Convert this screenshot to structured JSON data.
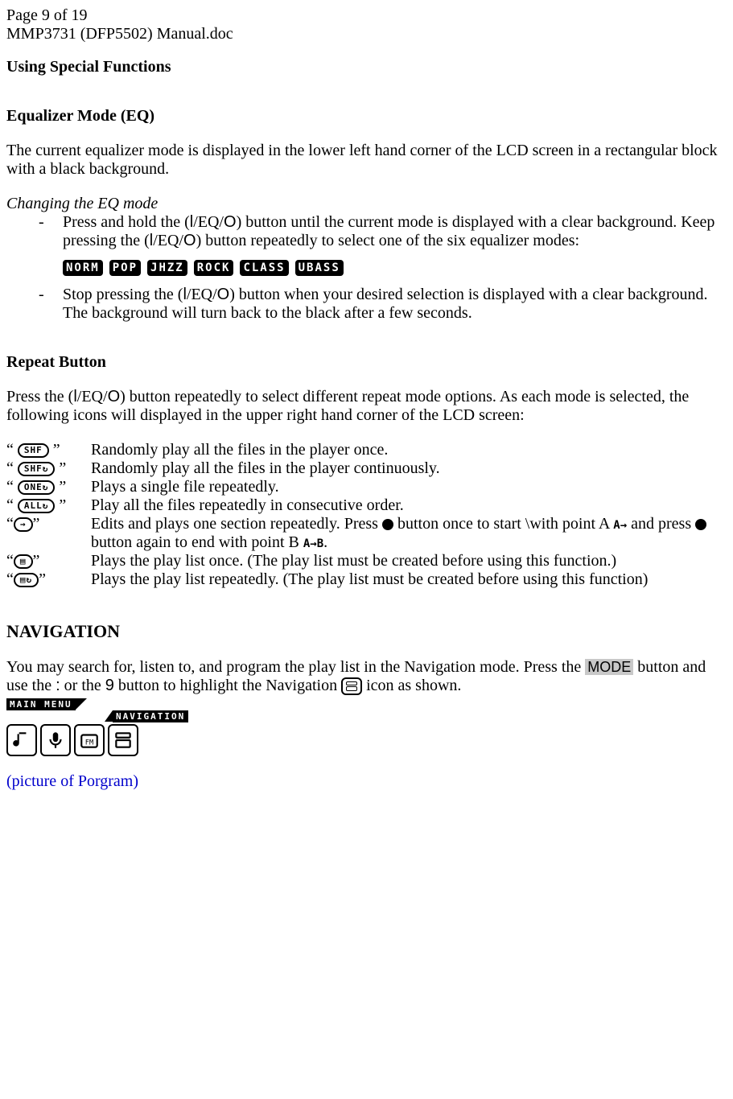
{
  "header": {
    "page_indicator": "Page 9 of 19",
    "doc_title": "MMP3731 (DFP5502) Manual.doc"
  },
  "section1": {
    "title": "Using Special Functions",
    "eq_title": "Equalizer Mode (EQ)",
    "eq_intro": "The current equalizer mode is displayed in the lower left hand corner of the LCD screen in a rectangular block with a black background.",
    "eq_change_heading": "Changing the EQ mode",
    "eq_step1_a": "Press and hold the (",
    "eq_step1_b": "/EQ/",
    "eq_step1_c": ") button until the current mode is displayed with a clear background.  Keep pressing the (",
    "eq_step1_d": "/EQ/",
    "eq_step1_e": ") button repeatedly to select one of the six equalizer modes:",
    "eq_badges": [
      "NORM",
      "POP",
      "JHZZ",
      "ROCK",
      "CLASS",
      "UBASS"
    ],
    "eq_step2_a": "Stop pressing the (",
    "eq_step2_b": "/EQ/",
    "eq_step2_c": ") button when your desired selection is displayed with a clear background.  The background will turn back to the black after a few seconds.",
    "sym_l": "l",
    "sym_o": "O",
    "dash": "-"
  },
  "repeat": {
    "title": "Repeat Button",
    "intro_a": "Press the (",
    "intro_b": "/EQ/",
    "intro_c": ") button repeatedly to select different repeat mode options.  As each mode is selected, the following icons will displayed in the upper right hand corner of the LCD screen:",
    "sym_l": "l",
    "sym_o": "O",
    "items": [
      {
        "icon": "SHF",
        "desc": "Randomly play all the files in the player once."
      },
      {
        "icon": "SHF↻",
        "desc": "Randomly play all the files in the player continuously."
      },
      {
        "icon": "ONE↻",
        "desc": "Plays a single file repeatedly."
      },
      {
        "icon": "ALL↻",
        "desc": "Play all the files repeatedly in consecutive order."
      }
    ],
    "ab": {
      "icon": "→",
      "desc_a": "Edits and plays one section repeatedly.  Press ",
      "desc_b": " button once to start \\with point A ",
      "ab_a": "A→",
      "desc_c": " and press  ",
      "desc_d": " button again to end with point B  ",
      "ab_b": "A→B",
      "desc_e": "."
    },
    "pl1": {
      "icon": "▤",
      "desc": "Plays the play list once. (The play list must be created before using this function.)"
    },
    "pl2": {
      "icon": "▤↻",
      "desc": "Plays the play list repeatedly. (The play list must be created before using this function)"
    },
    "q_open": "“ ",
    "q_close": " ”",
    "q_open_tight": "“",
    "q_close_tight": "”"
  },
  "nav": {
    "title": "NAVIGATION",
    "p_a": "You may search for, listen to, and program the play list in the Navigation mode.  Press the ",
    "mode_label": "MODE",
    "p_b": "  button and use the ",
    "sym_colon": ":",
    "p_c": "   or the ",
    "sym_9": "9",
    "p_d": "  button to highlight the Navigation ",
    "p_e": " icon as shown.",
    "mm_label": "MAIN MENU",
    "mm_nav_label": "NAVIGATION",
    "picture_note": "(picture of Porgram)"
  }
}
